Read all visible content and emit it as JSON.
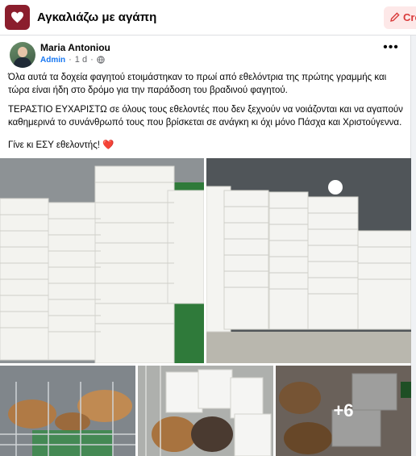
{
  "group": {
    "title": "Αγκαλιάζω με αγάπη",
    "create_label": "Cre"
  },
  "post": {
    "author": "Maria Antoniou",
    "role_badge": "Admin",
    "timestamp": "1 d",
    "separator": "·",
    "more_label": "•••",
    "paragraph1": "Όλα αυτά τα δοχεία φαγητού ετοιμάστηκαν το πρωί από εθελόντρια της πρώτης γραμμής και τώρα είναι ήδη στο δρόμο για την παράδοση του βραδινού φαγητού.",
    "paragraph2": "ΤΕΡΑΣΤΙΟ ΕΥΧΑΡΙΣΤΩ σε όλους τους εθελοντές που δεν ξεχνούν να νοιάζονται και να αγαπούν καθημερινά το συνάνθρωπό τους που βρίσκεται σε ανάγκη κι όχι μόνο Πάσχα και Χριστούγεννα.",
    "paragraph3": "Γίνε κι ΕΣΥ εθελοντής!",
    "heart": "❤️"
  },
  "photos": {
    "extra_count": "+6"
  },
  "colors": {
    "accent_blue": "#1877f2",
    "create_bg": "#fde8e8",
    "create_text": "#d93a3a",
    "group_avatar": "#8b1e2d"
  }
}
